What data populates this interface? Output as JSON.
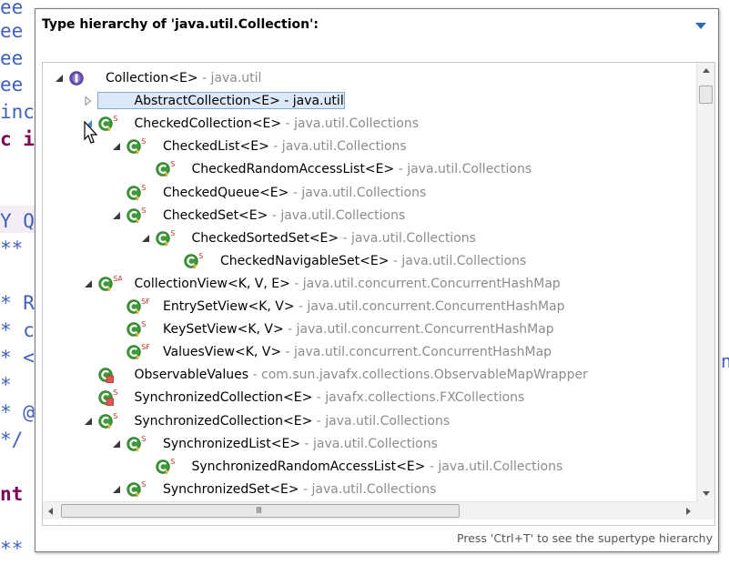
{
  "editor": {
    "lines": [
      {
        "text": "ee",
        "cls": "ed-comment"
      },
      {
        "text": "ee",
        "cls": "ed-comment"
      },
      {
        "text": "ee",
        "cls": "ed-comment"
      },
      {
        "text": "ee",
        "cls": "ed-comment"
      },
      {
        "text": "inc",
        "cls": "ed-comment"
      },
      {
        "text": "c i",
        "cls": "ed-kw"
      },
      {
        "text": "Y Q",
        "cls": "ed-plain"
      },
      {
        "text": "**",
        "cls": "ed-comment"
      },
      {
        "text": "* R",
        "cls": "ed-comment"
      },
      {
        "text": "* c",
        "cls": "ed-comment"
      },
      {
        "text": "* <",
        "cls": "ed-comment"
      },
      {
        "text": "*",
        "cls": "ed-comment"
      },
      {
        "text": "* @",
        "cls": "ed-comment"
      },
      {
        "text": "*/",
        "cls": "ed-comment"
      },
      {
        "text": "nt",
        "cls": "ed-kw"
      },
      {
        "text": "**",
        "cls": "ed-comment"
      }
    ]
  },
  "popup": {
    "title": "Type hierarchy of 'java.util.Collection':",
    "status_hint": "Press 'Ctrl+T' to see the supertype hierarchy"
  },
  "tree": [
    {
      "name": "Collection<E>",
      "pkg": " - java.util",
      "level": 0,
      "expander": "expanded",
      "icon": "interface",
      "badge": ""
    },
    {
      "name": "AbstractCollection<E>",
      "pkg": " - java.util",
      "level": 1,
      "expander": "collapsed",
      "icon": "class",
      "badge": "A",
      "selected": true
    },
    {
      "name": "CheckedCollection<E>",
      "pkg": " - java.util.Collections",
      "level": 1,
      "expander": "expanded-hover",
      "icon": "class",
      "badge": "S"
    },
    {
      "name": "CheckedList<E>",
      "pkg": " - java.util.Collections",
      "level": 2,
      "expander": "expanded",
      "icon": "class",
      "badge": "S"
    },
    {
      "name": "CheckedRandomAccessList<E>",
      "pkg": " - java.util.Collections",
      "level": 3,
      "expander": "none",
      "icon": "class",
      "badge": "S"
    },
    {
      "name": "CheckedQueue<E>",
      "pkg": " - java.util.Collections",
      "level": 2,
      "expander": "none",
      "icon": "class",
      "badge": "S"
    },
    {
      "name": "CheckedSet<E>",
      "pkg": " - java.util.Collections",
      "level": 2,
      "expander": "expanded",
      "icon": "class",
      "badge": "S"
    },
    {
      "name": "CheckedSortedSet<E>",
      "pkg": " - java.util.Collections",
      "level": 3,
      "expander": "expanded",
      "icon": "class",
      "badge": "S"
    },
    {
      "name": "CheckedNavigableSet<E>",
      "pkg": " - java.util.Collections",
      "level": 4,
      "expander": "none",
      "icon": "class",
      "badge": "S"
    },
    {
      "name": "CollectionView<K, V, E>",
      "pkg": " - java.util.concurrent.ConcurrentHashMap",
      "level": 1,
      "expander": "expanded",
      "icon": "class",
      "badge": "SA"
    },
    {
      "name": "EntrySetView<K, V>",
      "pkg": " - java.util.concurrent.ConcurrentHashMap",
      "level": 2,
      "expander": "none",
      "icon": "class",
      "badge": "SF"
    },
    {
      "name": "KeySetView<K, V>",
      "pkg": " - java.util.concurrent.ConcurrentHashMap",
      "level": 2,
      "expander": "none",
      "icon": "class",
      "badge": "S"
    },
    {
      "name": "ValuesView<K, V>",
      "pkg": " - java.util.concurrent.ConcurrentHashMap",
      "level": 2,
      "expander": "none",
      "icon": "class",
      "badge": "SF"
    },
    {
      "name": "ObservableValues",
      "pkg": " - com.sun.javafx.collections.ObservableMapWrapper",
      "level": 1,
      "expander": "none",
      "icon": "class-private",
      "badge": ""
    },
    {
      "name": "SynchronizedCollection<E>",
      "pkg": " - javafx.collections.FXCollections",
      "level": 1,
      "expander": "none",
      "icon": "class-private",
      "badge": "S"
    },
    {
      "name": "SynchronizedCollection<E>",
      "pkg": " - java.util.Collections",
      "level": 1,
      "expander": "expanded",
      "icon": "class",
      "badge": "S"
    },
    {
      "name": "SynchronizedList<E>",
      "pkg": " - java.util.Collections",
      "level": 2,
      "expander": "expanded",
      "icon": "class",
      "badge": "S"
    },
    {
      "name": "SynchronizedRandomAccessList<E>",
      "pkg": " - java.util.Collections",
      "level": 3,
      "expander": "none",
      "icon": "class",
      "badge": "S"
    },
    {
      "name": "SynchronizedSet<E>",
      "pkg": " - java.util.Collections",
      "level": 2,
      "expander": "expanded",
      "icon": "class",
      "badge": "S"
    }
  ],
  "colors": {
    "class_green": "#3e9a3b",
    "interface_purple": "#6a4fb3",
    "badge_red": "#c0392b",
    "private_red": "#e05656",
    "selection_border": "#7ea8d8",
    "view_menu_arrow": "#2d6db5"
  }
}
